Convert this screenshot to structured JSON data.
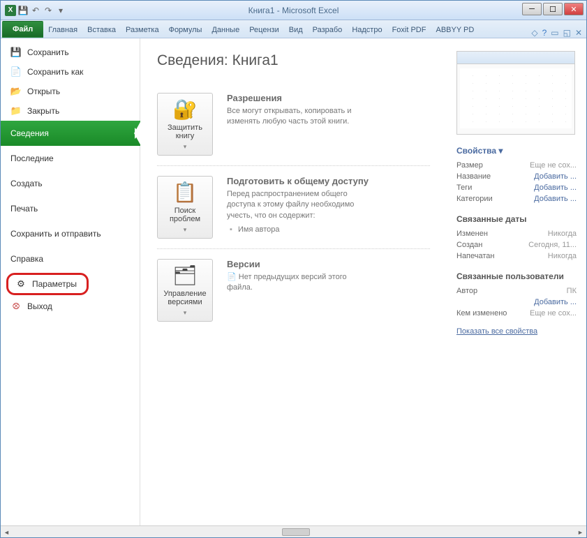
{
  "window": {
    "title": "Книга1  -  Microsoft Excel",
    "app_icon_letter": "X"
  },
  "ribbon": {
    "file": "Файл",
    "tabs": [
      "Главная",
      "Вставка",
      "Разметка",
      "Формулы",
      "Данные",
      "Рецензи",
      "Вид",
      "Разрабо",
      "Надстро",
      "Foxit PDF",
      "ABBYY PD"
    ]
  },
  "sidebar": {
    "save": "Сохранить",
    "save_as": "Сохранить как",
    "open": "Открыть",
    "close": "Закрыть",
    "info": "Сведения",
    "recent": "Последние",
    "new": "Создать",
    "print": "Печать",
    "save_send": "Сохранить и отправить",
    "help": "Справка",
    "options": "Параметры",
    "exit": "Выход"
  },
  "main": {
    "title": "Сведения: Книга1",
    "permissions": {
      "btn": "Защитить книгу",
      "heading": "Разрешения",
      "text": "Все могут открывать, копировать и изменять любую часть этой книги."
    },
    "prepare": {
      "btn": "Поиск проблем",
      "heading": "Подготовить к общему доступу",
      "text": "Перед распространением общего доступа к этому файлу необходимо учесть, что он содержит:",
      "item1": "Имя автора"
    },
    "versions": {
      "btn": "Управление версиями",
      "heading": "Версии",
      "text": "Нет предыдущих версий этого файла."
    }
  },
  "props": {
    "dropdown": "Свойства",
    "size_k": "Размер",
    "size_v": "Еще не сох...",
    "title_k": "Название",
    "title_v": "Добавить ...",
    "tags_k": "Теги",
    "tags_v": "Добавить ...",
    "cats_k": "Категории",
    "cats_v": "Добавить ...",
    "dates_h": "Связанные даты",
    "mod_k": "Изменен",
    "mod_v": "Никогда",
    "created_k": "Создан",
    "created_v": "Сегодня, 11...",
    "printed_k": "Напечатан",
    "printed_v": "Никогда",
    "users_h": "Связанные пользователи",
    "author_k": "Автор",
    "author_v": "ПК",
    "author_add": "Добавить ...",
    "changed_k": "Кем изменено",
    "changed_v": "Еще не сох...",
    "show_all": "Показать все свойства"
  }
}
